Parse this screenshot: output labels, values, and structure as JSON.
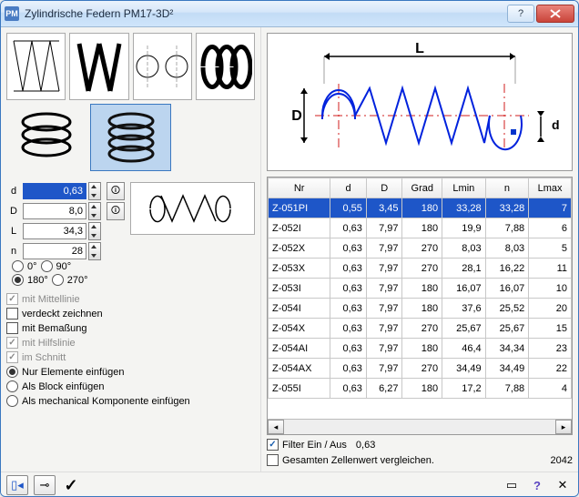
{
  "window": {
    "title": "Zylindrische Federn  PM17-3D²",
    "icon_text": "PM"
  },
  "params": {
    "d": {
      "label": "d",
      "value": "0,63"
    },
    "D": {
      "label": "D",
      "value": "8,0"
    },
    "L": {
      "label": "L",
      "value": "34,3"
    },
    "n": {
      "label": "n",
      "value": "28"
    }
  },
  "angles": {
    "a0": "0°",
    "a90": "90°",
    "a180": "180°",
    "a270": "270°",
    "selected": "180°"
  },
  "options": {
    "mittellinie": {
      "label": "mit Mittellinie",
      "checked": true,
      "disabled": true
    },
    "verdeckt": {
      "label": "verdeckt zeichnen",
      "checked": false,
      "disabled": false
    },
    "bemassung": {
      "label": "mit Bemaßung",
      "checked": false,
      "disabled": false
    },
    "hilfslinie": {
      "label": "mit Hilfslinie",
      "checked": true,
      "disabled": true
    },
    "schnitt": {
      "label": "im Schnitt",
      "checked": true,
      "disabled": true
    },
    "elemente": {
      "label": "Nur Elemente einfügen"
    },
    "block": {
      "label": "Als Block einfügen"
    },
    "mech": {
      "label": "Als mechanical Komponente einfügen"
    },
    "insert_mode": "elemente"
  },
  "diagram": {
    "L_label": "L",
    "D_label": "D",
    "d_label": "d"
  },
  "table": {
    "headers": [
      "Nr",
      "d",
      "D",
      "Grad",
      "Lmin",
      "n",
      "Lmax"
    ],
    "rows": [
      {
        "nr": "Z-051PI",
        "d": "0,55",
        "D": "3,45",
        "grad": "180",
        "lmin": "33,28",
        "n": "33,28",
        "lmax": "7"
      },
      {
        "nr": "Z-052I",
        "d": "0,63",
        "D": "7,97",
        "grad": "180",
        "lmin": "19,9",
        "n": "7,88",
        "lmax": "6"
      },
      {
        "nr": "Z-052X",
        "d": "0,63",
        "D": "7,97",
        "grad": "270",
        "lmin": "8,03",
        "n": "8,03",
        "lmax": "5"
      },
      {
        "nr": "Z-053X",
        "d": "0,63",
        "D": "7,97",
        "grad": "270",
        "lmin": "28,1",
        "n": "16,22",
        "lmax": "11"
      },
      {
        "nr": "Z-053I",
        "d": "0,63",
        "D": "7,97",
        "grad": "180",
        "lmin": "16,07",
        "n": "16,07",
        "lmax": "10"
      },
      {
        "nr": "Z-054I",
        "d": "0,63",
        "D": "7,97",
        "grad": "180",
        "lmin": "37,6",
        "n": "25,52",
        "lmax": "20"
      },
      {
        "nr": "Z-054X",
        "d": "0,63",
        "D": "7,97",
        "grad": "270",
        "lmin": "25,67",
        "n": "25,67",
        "lmax": "15"
      },
      {
        "nr": "Z-054AI",
        "d": "0,63",
        "D": "7,97",
        "grad": "180",
        "lmin": "46,4",
        "n": "34,34",
        "lmax": "23"
      },
      {
        "nr": "Z-054AX",
        "d": "0,63",
        "D": "7,97",
        "grad": "270",
        "lmin": "34,49",
        "n": "34,49",
        "lmax": "22"
      },
      {
        "nr": "Z-055I",
        "d": "0,63",
        "D": "6,27",
        "grad": "180",
        "lmin": "17,2",
        "n": "7,88",
        "lmax": "4"
      }
    ],
    "selected_index": 0
  },
  "filter": {
    "label": "Filter Ein / Aus",
    "value": "0,63",
    "checked": true
  },
  "compare": {
    "label": "Gesamten Zellenwert vergleichen.",
    "checked": false,
    "count": "2042"
  }
}
